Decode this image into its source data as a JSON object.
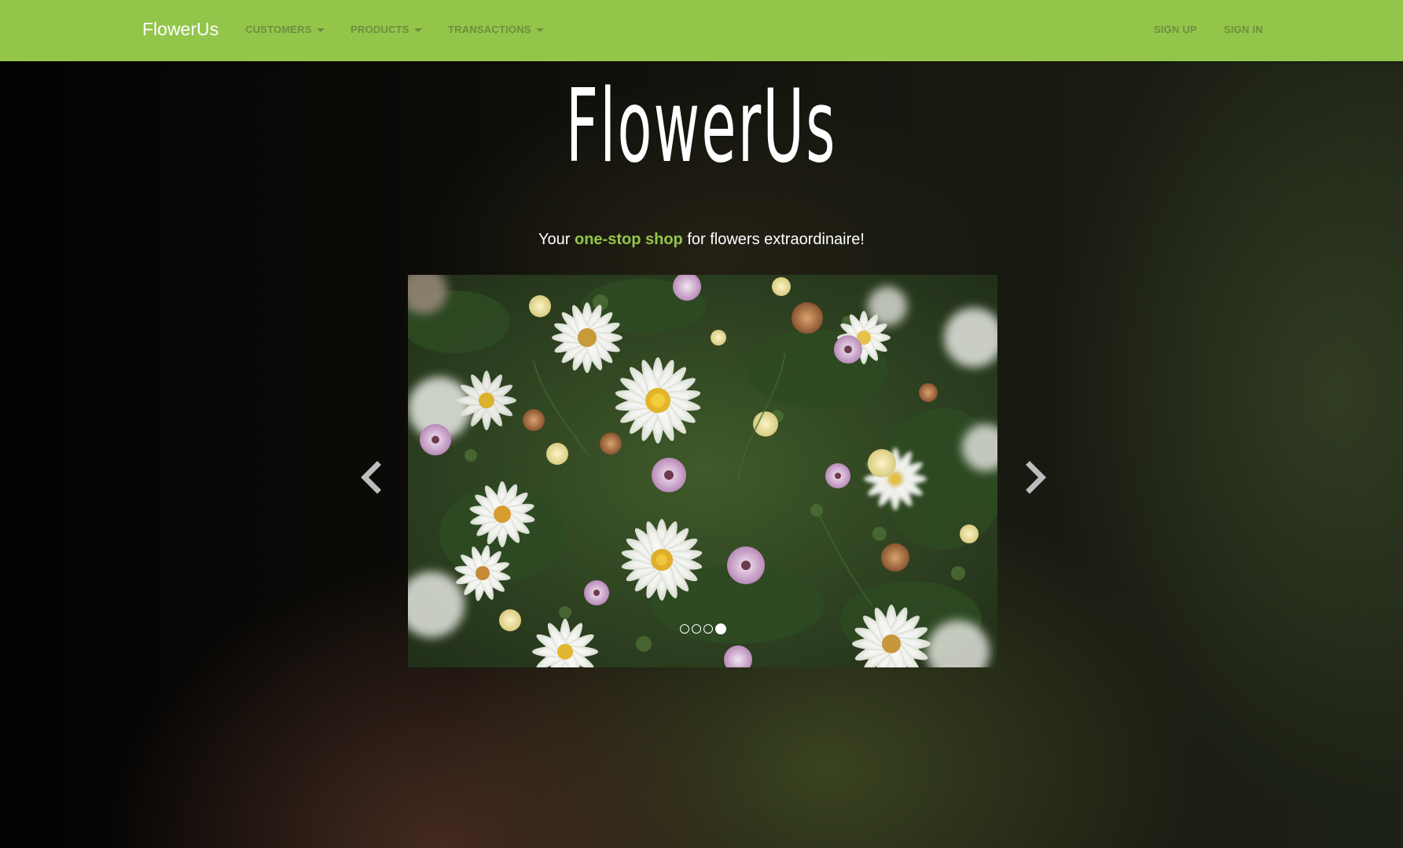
{
  "navbar": {
    "brand": "FlowerUs",
    "menus": [
      {
        "label": "CUSTOMERS"
      },
      {
        "label": "PRODUCTS"
      },
      {
        "label": "TRANSACTIONS"
      }
    ],
    "auth": {
      "signup": "SIGN UP",
      "signin": "SIGN IN"
    },
    "color": "#93c54b"
  },
  "hero": {
    "title": "FlowerUs",
    "tagline_pre": "Your ",
    "tagline_highlight": "one-stop shop",
    "tagline_post": " for flowers extraordinaire!",
    "highlight_color": "#93c54b"
  },
  "carousel": {
    "slide_count": 4,
    "active_index": 3,
    "prev_icon": "chevron-left-icon",
    "next_icon": "chevron-right-icon"
  }
}
